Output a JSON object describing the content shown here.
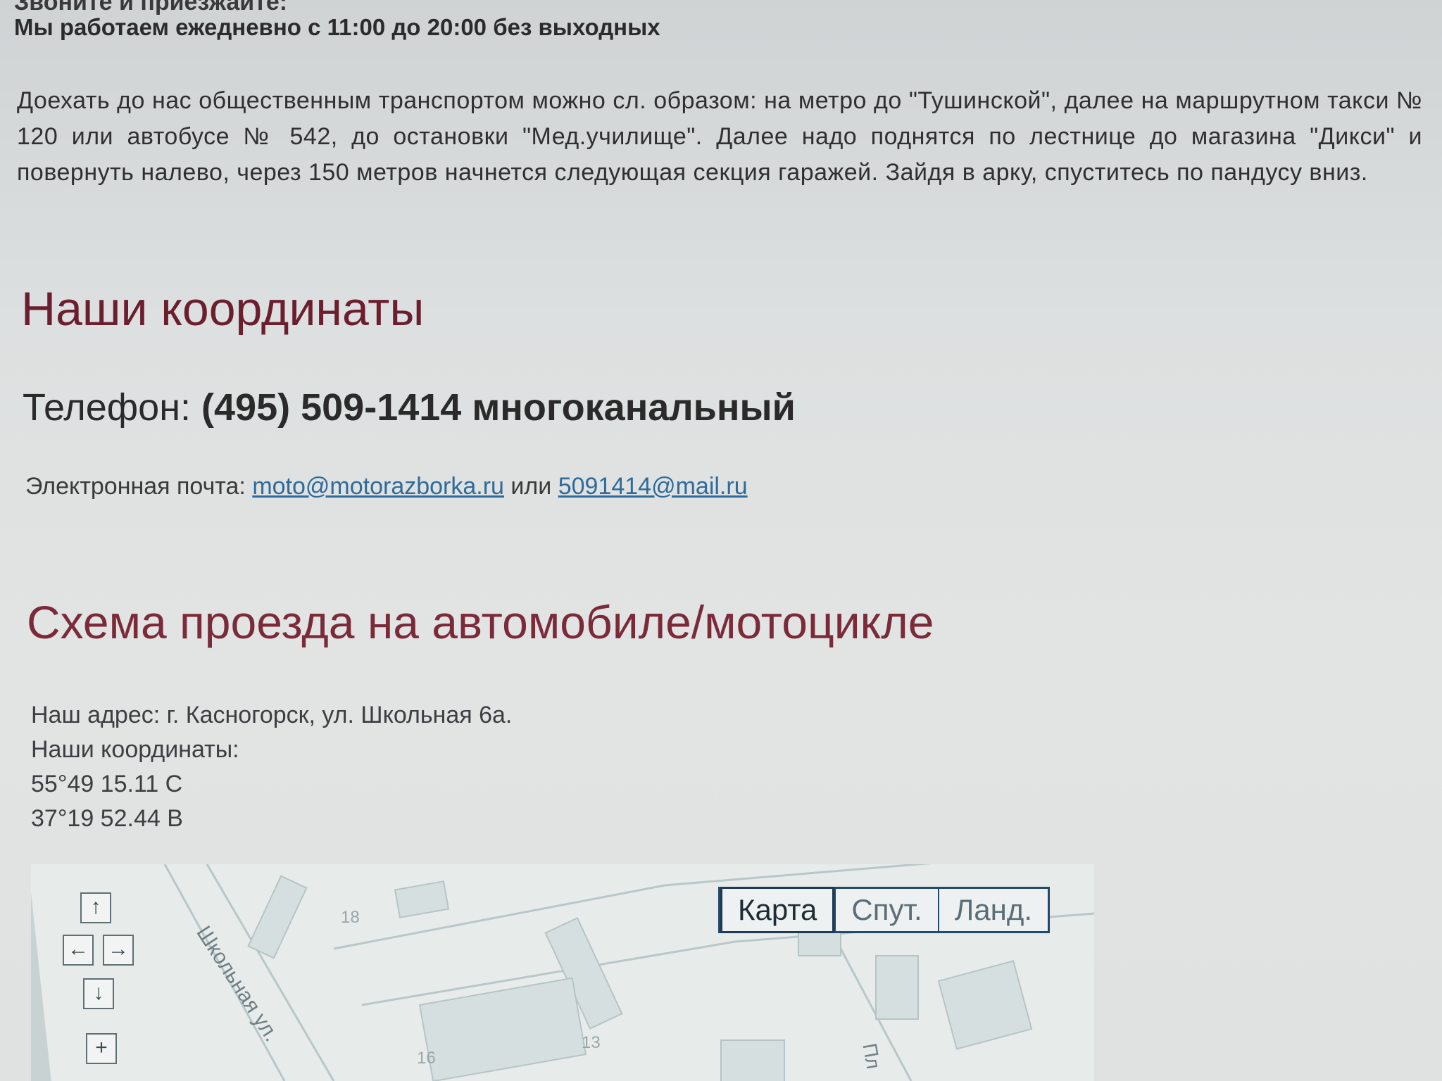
{
  "page": {
    "top_cut_text": "Звоните и приезжайте:",
    "hours": "Мы работаем ежедневно с 11:00 до 20:00 без выходных",
    "directions": "Доехать до нас общественным транспортом можно сл. образом: на метро до \"Тушинской\", далее на маршрутном такси № 120 или автобусе № 542, до остановки \"Мед.училище\". Далее надо поднятся по лестнице до магазина \"Дикси\" и повернуть налево, через 150 метров начнется следующая секция гаражей. Зайдя в арку, спуститесь по пандусу вниз.",
    "coords_heading": "Наши координаты",
    "phone_label": "Телефон:",
    "phone_number": "(495) 509-1414 многоканальный",
    "email_label": "Электронная почта:",
    "email_1": "moto@motorazborka.ru",
    "email_or": "или",
    "email_2": "5091414@mail.ru",
    "scheme_heading": "Схема проезда на автомобиле/мотоцикле",
    "address": "Наш адрес: г. Касногорск, ул. Школьная 6а.",
    "coords_label": "Наши координаты:",
    "lat": "55°49 15.11 С",
    "lon": "37°19 52.44 В"
  },
  "map": {
    "street_1": "Школьная ул.",
    "street_2": "Пл",
    "house_18": "18",
    "house_16": "16",
    "house_13": "13",
    "nav": {
      "up": "↑",
      "left": "←",
      "right": "→",
      "down": "↓",
      "zoom_in": "+"
    },
    "types": {
      "map": "Карта",
      "satellite": "Спут.",
      "landscape": "Ланд."
    }
  },
  "colors": {
    "heading": "#6b1f2e",
    "link": "#2f6b9a",
    "maptype_border": "#234a6a"
  }
}
